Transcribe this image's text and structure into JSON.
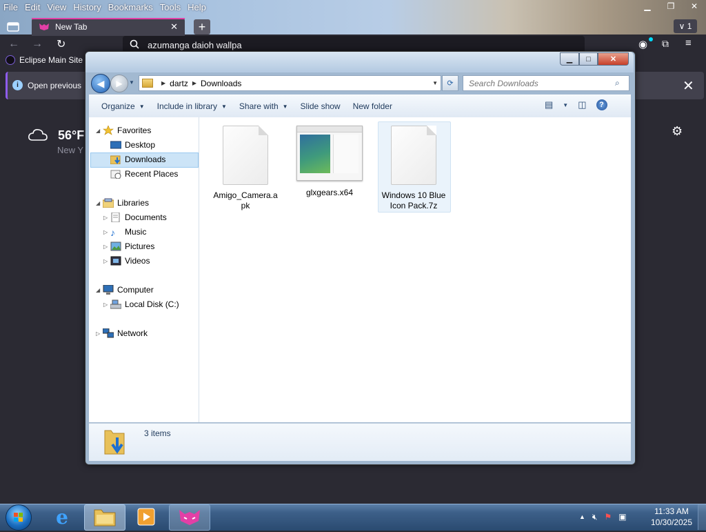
{
  "browser": {
    "menu": [
      "File",
      "Edit",
      "View",
      "History",
      "Bookmarks",
      "Tools",
      "Help"
    ],
    "tab_label": "New Tab",
    "tab_count": "1",
    "url_text": "azumanga daioh wallpa",
    "bookmark_label": "Eclipse Main Site",
    "notification_text": "Open previous",
    "weather_temp": "56°F",
    "weather_sub": "New Y"
  },
  "explorer": {
    "breadcrumb": [
      "dartz",
      "Downloads"
    ],
    "search_placeholder": "Search Downloads",
    "toolbar": {
      "organize": "Organize",
      "include": "Include in library",
      "share": "Share with",
      "slideshow": "Slide show",
      "newfolder": "New folder"
    },
    "nav": {
      "favorites": "Favorites",
      "desktop": "Desktop",
      "downloads": "Downloads",
      "recent": "Recent Places",
      "libraries": "Libraries",
      "documents": "Documents",
      "music": "Music",
      "pictures": "Pictures",
      "videos": "Videos",
      "computer": "Computer",
      "localdisk": "Local Disk (C:)",
      "network": "Network"
    },
    "files": [
      {
        "name_line1": "Amigo_Camera.a",
        "name_line2": "pk",
        "icon": "document-icon"
      },
      {
        "name_line1": "glxgears.x64",
        "name_line2": "",
        "icon": "window-thumbnail-icon"
      },
      {
        "name_line1": "Windows 10 Blue",
        "name_line2": "Icon Pack.7z",
        "icon": "document-icon",
        "selected": true
      }
    ],
    "item_count": "3 items"
  },
  "taskbar": {
    "time": "11:33 AM",
    "date": "10/30/2025"
  },
  "colors": {
    "accent": "#e33fa6",
    "selection": "#cce4f7",
    "taskbar": "#2a4a70"
  }
}
